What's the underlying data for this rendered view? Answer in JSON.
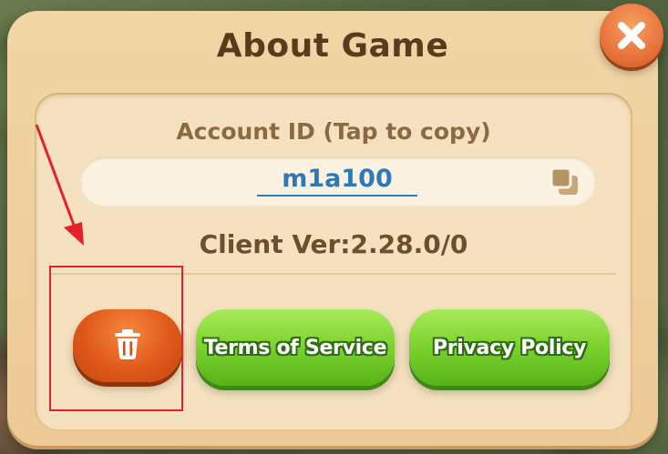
{
  "dialog": {
    "title": "About Game",
    "account_label": "Account ID (Tap to copy)",
    "account_id": "m1a100",
    "client_version": "Client Ver:2.28.0/0"
  },
  "buttons": {
    "delete_icon": "trash-icon",
    "terms_label": "Terms of Service",
    "privacy_label": "Privacy Policy",
    "close_icon": "close-icon",
    "copy_icon": "copy-icon"
  },
  "colors": {
    "annotation": "#e5202b",
    "title_text": "#5b3a1e",
    "account_id_text": "#2e79b9",
    "green_button": "#76cf2a",
    "delete_button": "#e0591b",
    "close_button": "#e8743b"
  }
}
